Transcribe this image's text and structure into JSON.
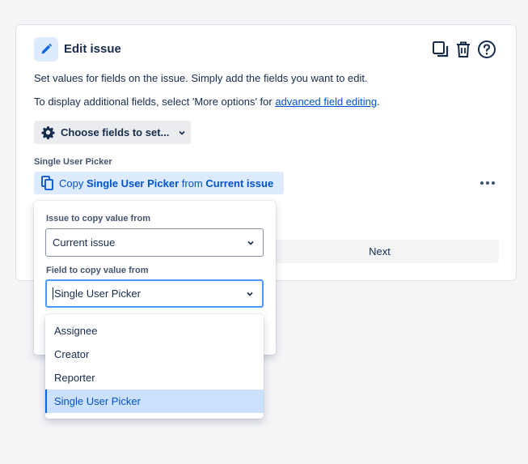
{
  "header": {
    "title": "Edit issue",
    "icons": [
      "pencil-icon",
      "copy-icon",
      "trash-icon",
      "help-icon"
    ]
  },
  "description": {
    "line1": "Set values for fields on the issue. Simply add the fields you want to edit.",
    "line2_prefix": "To display additional fields, select 'More options' for ",
    "line2_link": "advanced field editing",
    "line2_suffix": "."
  },
  "choose_button": {
    "label": "Choose fields to set..."
  },
  "field": {
    "label": "Single User Picker",
    "copy_prefix": "Copy ",
    "copy_field": "Single User Picker",
    "copy_middle": " from ",
    "copy_source": "Current issue"
  },
  "next_button": {
    "label": "Next"
  },
  "popup": {
    "issue_label": "Issue to copy value from",
    "issue_value": "Current issue",
    "field_label": "Field to copy value from",
    "field_value": "Single User Picker"
  },
  "dropdown": {
    "options": [
      "Assignee",
      "Creator",
      "Reporter",
      "Single User Picker"
    ],
    "selected": "Single User Picker"
  },
  "colors": {
    "accent": "#0052cc",
    "selected_bg": "#cce0ff",
    "focus_border": "#4c9aff"
  }
}
